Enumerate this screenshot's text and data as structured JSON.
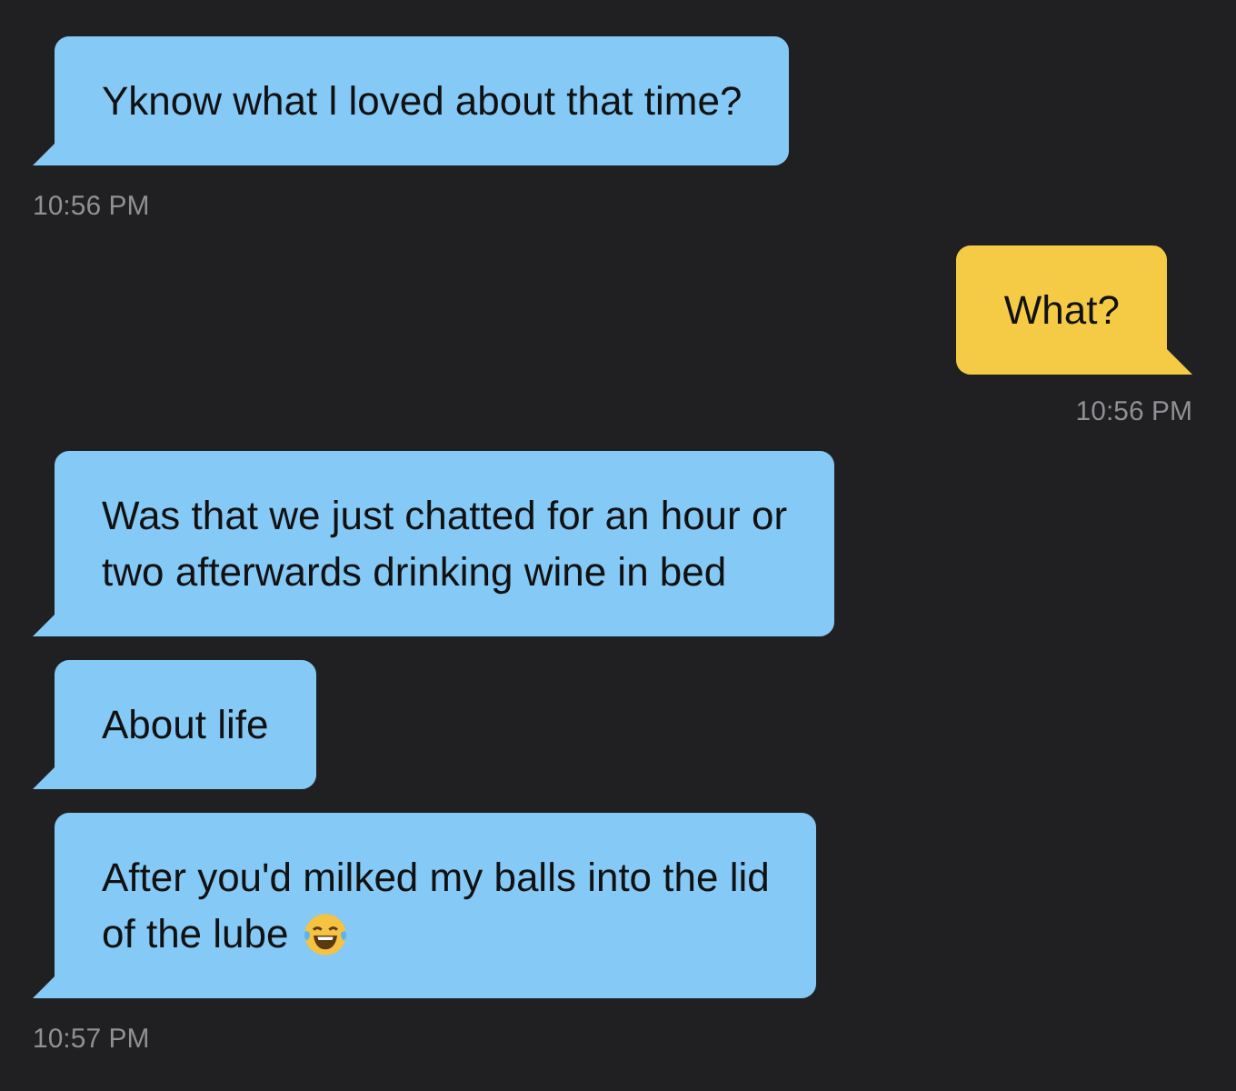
{
  "messages": [
    {
      "kind": "message",
      "outgoing": false,
      "lines": [
        "Yknow what l loved about that time?"
      ],
      "emoji": false
    },
    {
      "kind": "time",
      "text": "10:56 PM",
      "outgoing": false
    },
    {
      "kind": "message",
      "outgoing": true,
      "lines": [
        "What?"
      ],
      "emoji": false
    },
    {
      "kind": "time",
      "text": "10:56 PM",
      "outgoing": true
    },
    {
      "kind": "message",
      "outgoing": false,
      "lines": [
        "Was that we just chatted for an hour or",
        "two afterwards drinking wine in bed"
      ],
      "emoji": false
    },
    {
      "kind": "message",
      "outgoing": false,
      "lines": [
        "About life"
      ],
      "emoji": false
    },
    {
      "kind": "message",
      "outgoing": false,
      "lines": [
        "After you'd milked my balls into the lid",
        "of the lube"
      ],
      "emoji": true
    },
    {
      "kind": "time",
      "text": "10:57 PM",
      "outgoing": false
    }
  ]
}
